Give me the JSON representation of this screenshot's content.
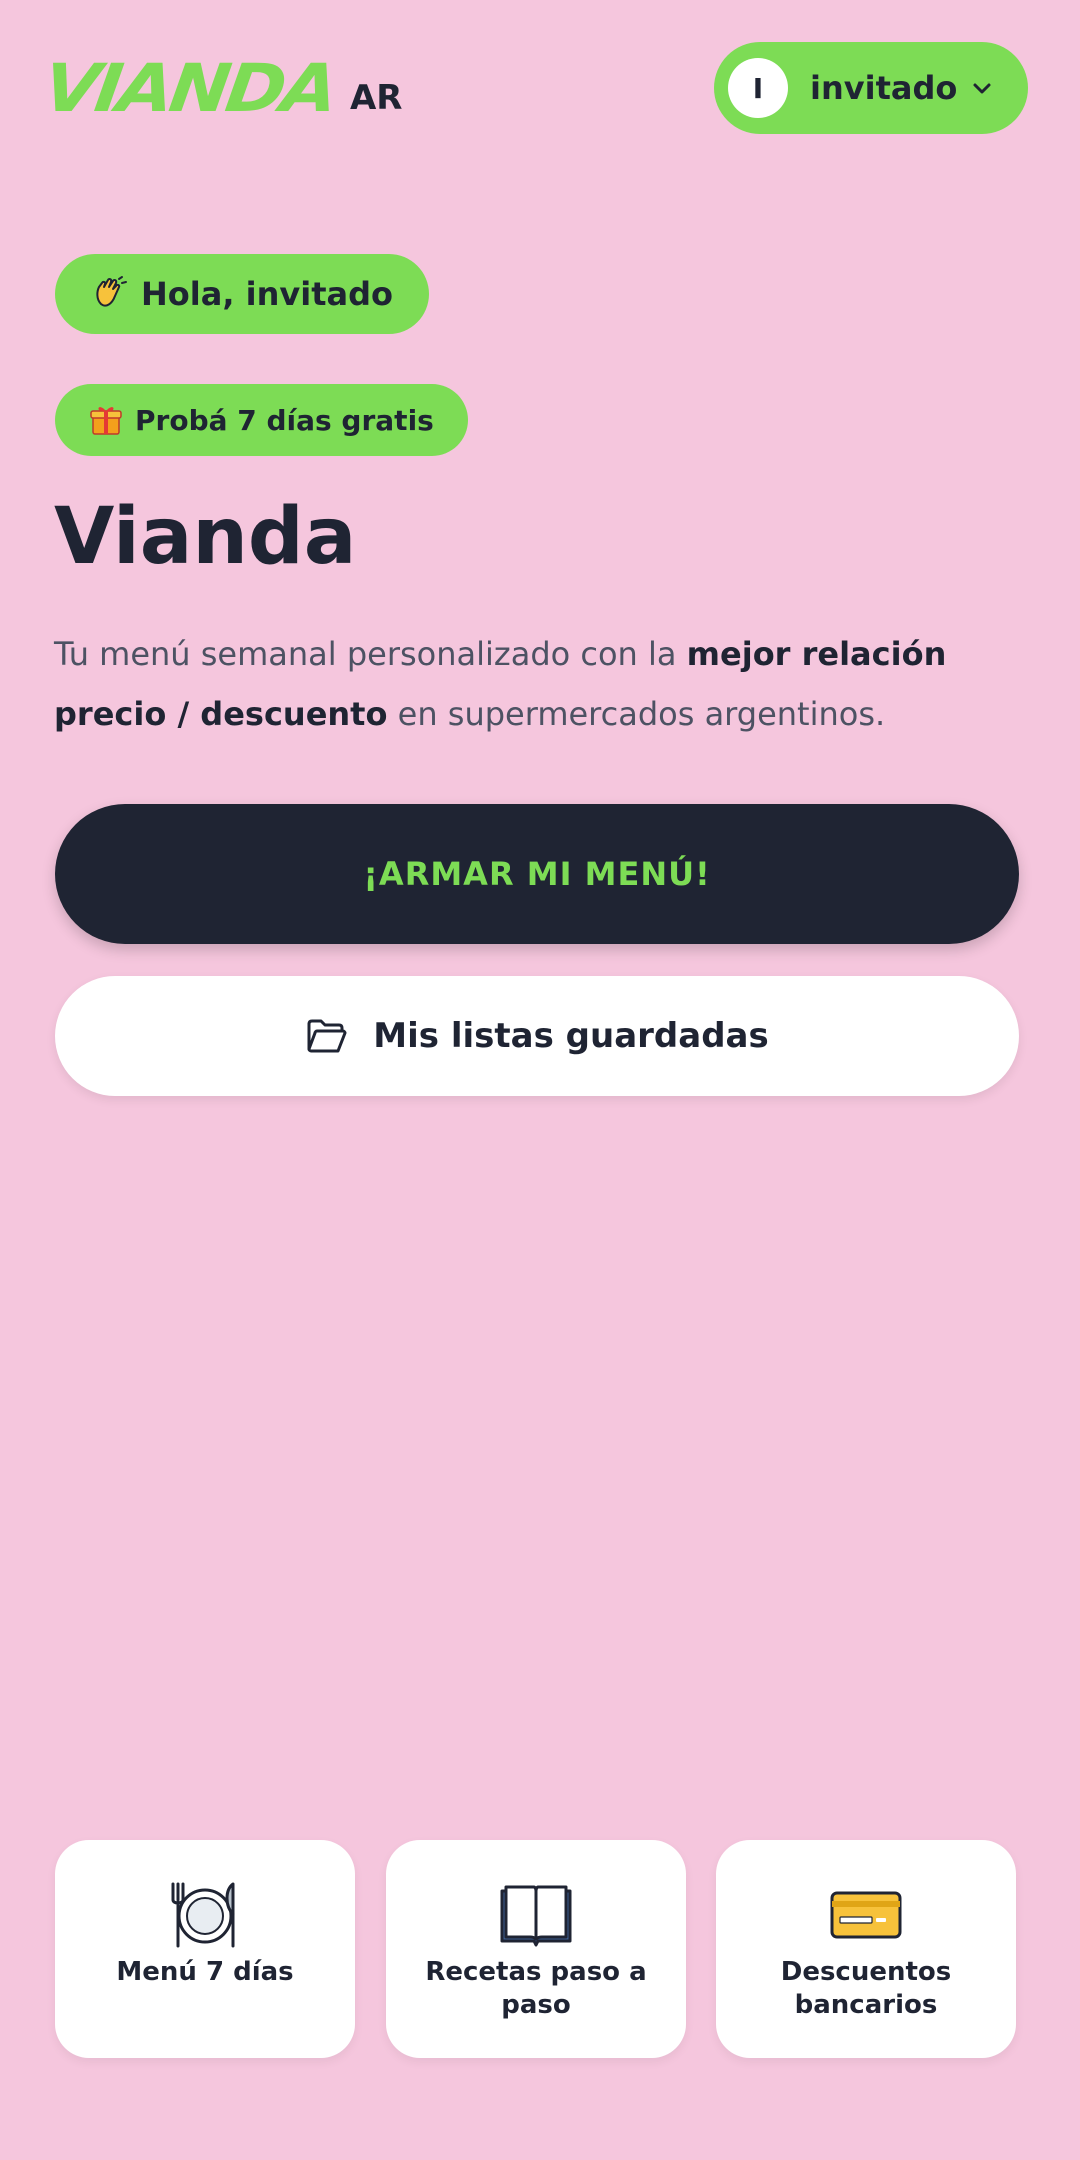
{
  "header": {
    "logo_text": "VIANDA",
    "country": "AR",
    "user": {
      "initial": "I",
      "name": "invitado",
      "menu_icon": "chevron-down-icon"
    }
  },
  "hero": {
    "greeting": "Hola, invitado",
    "greeting_icon": "waving-hand-icon",
    "trial": "Probá 7 días gratis",
    "trial_icon": "gift-icon",
    "title": "Vianda",
    "subtitle_part1": "Tu menú semanal personalizado con la ",
    "subtitle_bold1": "mejor relación precio / descuento",
    "subtitle_part2": " en supermercados argentinos.",
    "primary_button": "¡ARMAR MI MENÚ!",
    "secondary_button": "Mis listas guardadas",
    "secondary_icon": "folder-open-icon"
  },
  "features": [
    {
      "label": "Menú 7 días",
      "icon": "plate-cutlery-icon"
    },
    {
      "label": "Recetas paso a paso",
      "icon": "open-book-icon"
    },
    {
      "label": "Descuentos bancarios",
      "icon": "credit-card-icon"
    }
  ],
  "colors": {
    "background": "#f5c6dd",
    "accent_green": "#7ddc55",
    "dark": "#1f2433",
    "white": "#ffffff"
  }
}
